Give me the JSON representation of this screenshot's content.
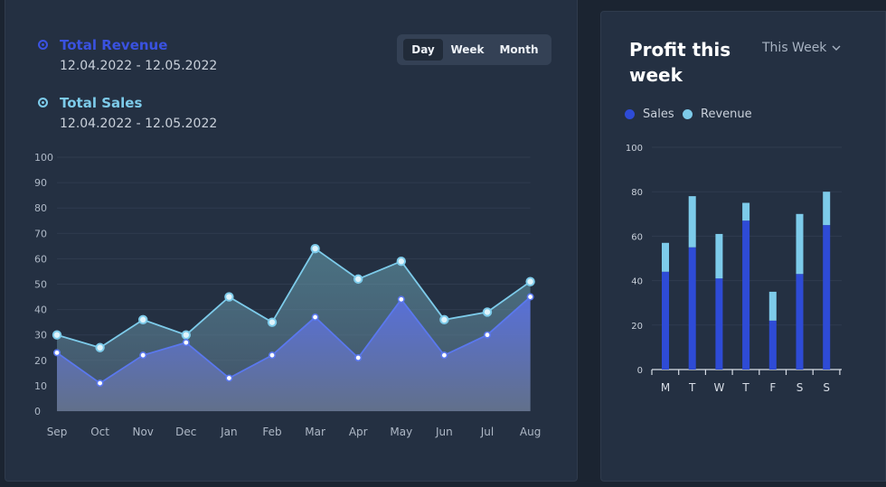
{
  "revenue_panel": {
    "legend": [
      {
        "name": "Total Revenue",
        "date_range": "12.04.2022 - 12.05.2022",
        "color": "#3a52e0"
      },
      {
        "name": "Total Sales",
        "date_range": "12.04.2022 - 12.05.2022",
        "color": "#7dcbea"
      }
    ],
    "range_toggle": {
      "options": [
        "Day",
        "Week",
        "Month"
      ],
      "selected": "Day"
    }
  },
  "profit_panel": {
    "title": "Profit this week",
    "period_select": {
      "value": "This Week",
      "icon": "chevron-down-icon"
    },
    "legend": [
      {
        "name": "Sales",
        "color": "#2e4bd6"
      },
      {
        "name": "Revenue",
        "color": "#7dcbea"
      }
    ]
  },
  "chart_data": [
    {
      "type": "area",
      "categories": [
        "Sep",
        "Oct",
        "Nov",
        "Dec",
        "Jan",
        "Feb",
        "Mar",
        "Apr",
        "May",
        "Jun",
        "Jul",
        "Aug"
      ],
      "series": [
        {
          "name": "Total Sales",
          "color": "#7dcbea",
          "values": [
            30,
            25,
            36,
            30,
            45,
            35,
            64,
            52,
            59,
            36,
            39,
            51
          ]
        },
        {
          "name": "Total Revenue",
          "color": "#5a78ee",
          "values": [
            23,
            11,
            22,
            27,
            13,
            22,
            37,
            21,
            44,
            22,
            30,
            45
          ]
        }
      ],
      "ylim": [
        0,
        100
      ],
      "yticks": [
        0,
        10,
        20,
        30,
        40,
        50,
        60,
        70,
        80,
        90,
        100
      ],
      "grid": true
    },
    {
      "type": "bar",
      "stacked": true,
      "categories": [
        "M",
        "T",
        "W",
        "T",
        "F",
        "S",
        "S"
      ],
      "series": [
        {
          "name": "Sales",
          "color": "#2e4bd6",
          "values": [
            44,
            55,
            41,
            67,
            22,
            43,
            65
          ]
        },
        {
          "name": "Revenue",
          "color": "#7dcbea",
          "values": [
            13,
            23,
            20,
            8,
            13,
            27,
            15
          ]
        }
      ],
      "ylim": [
        0,
        100
      ],
      "yticks": [
        0,
        20,
        40,
        60,
        80,
        100
      ],
      "grid": true
    }
  ]
}
